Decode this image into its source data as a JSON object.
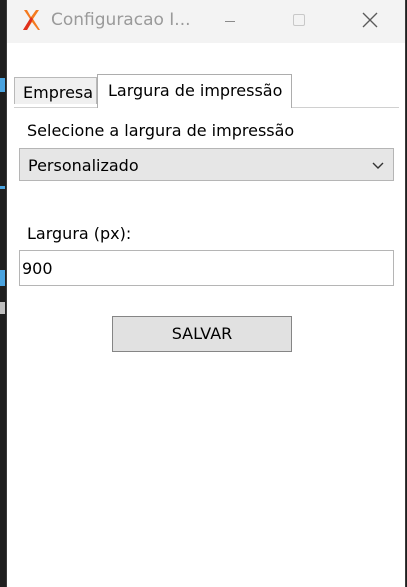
{
  "window": {
    "title": "Configuracao I...",
    "controls": {
      "minimize": "minimize-icon",
      "maximize": "maximize-icon",
      "close": "close-icon"
    }
  },
  "tabs": [
    {
      "label": "Empresa",
      "active": false
    },
    {
      "label": "Largura de impressão",
      "active": true
    }
  ],
  "form": {
    "select_label": "Selecione a largura de impressão",
    "select_value": "Personalizado",
    "width_label": "Largura (px):",
    "width_value": "900",
    "save_label": "SALVAR"
  },
  "colors": {
    "titlebar": "#f3f3f3",
    "window": "#ffffff",
    "button": "#e1e1e1",
    "logo_orange": "#f47a20",
    "logo_red": "#e0301e"
  }
}
